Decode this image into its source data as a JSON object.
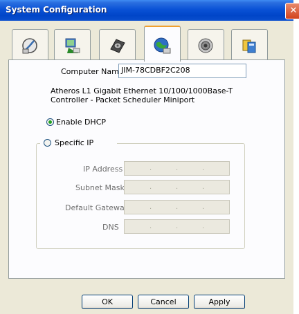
{
  "window": {
    "title": "System Configuration",
    "close_glyph": "✕"
  },
  "tabs": [
    {
      "icon": "network-tools-icon",
      "active": false
    },
    {
      "icon": "computer-icon",
      "active": false
    },
    {
      "icon": "hard-disk-icon",
      "active": false
    },
    {
      "icon": "network-globe-icon",
      "active": true
    },
    {
      "icon": "speaker-icon",
      "active": false
    },
    {
      "icon": "programs-icon",
      "active": false
    }
  ],
  "network": {
    "computer_name_label": "Computer Name",
    "computer_name_value": "JIM-78CDBF2C208",
    "adapter_line1": "Atheros L1 Gigabit Ethernet 10/100/1000Base-T",
    "adapter_line2": "Controller - Packet Scheduler Miniport",
    "enable_dhcp_label": "Enable DHCP",
    "enable_dhcp_selected": true,
    "specific_ip_label": "Specific IP",
    "specific_ip_selected": false,
    "ip_address_label": "IP Address",
    "subnet_mask_label": "Subnet Mask",
    "default_gateway_label": "Default Gateway",
    "dns_label": "DNS"
  },
  "buttons": {
    "ok": "OK",
    "cancel": "Cancel",
    "apply": "Apply"
  },
  "colors": {
    "titlebar": "#0a52d6",
    "window_bg": "#ece9d8",
    "active_tab_accent": "#f0a030",
    "radio_dot": "#21a121"
  }
}
